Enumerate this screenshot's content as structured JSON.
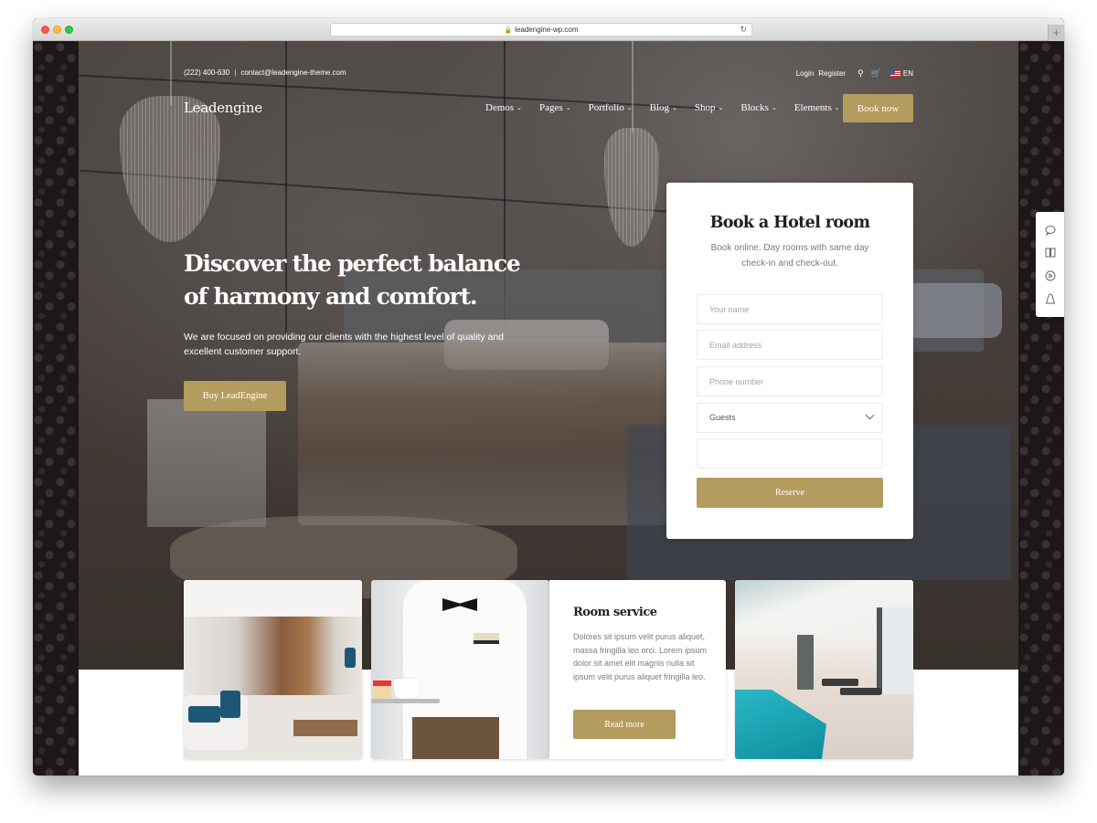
{
  "browser": {
    "url": "leadengine-wp.com",
    "lock_icon": "lock-icon",
    "reload_icon": "reload-icon",
    "new_tab_icon": "plus-icon"
  },
  "topbar": {
    "phone": "(222) 400-630",
    "separator": "|",
    "email": "contact@leadengine-theme.com",
    "login": "Login",
    "register": "Register",
    "language": "EN"
  },
  "header": {
    "logo": "Leadengine",
    "nav": [
      {
        "label": "Demos"
      },
      {
        "label": "Pages"
      },
      {
        "label": "Portfolio"
      },
      {
        "label": "Blog"
      },
      {
        "label": "Shop"
      },
      {
        "label": "Blocks"
      },
      {
        "label": "Elements"
      }
    ],
    "cta": "Book now"
  },
  "hero": {
    "title": "Discover the perfect balance of harmony and comfort.",
    "subtitle": "We are focused on providing our clients with the highest level of quality and excellent customer support.",
    "button": "Buy LeadEngine"
  },
  "booking": {
    "title": "Book a Hotel room",
    "subtitle": "Book online. Day rooms with same day check-in and check-out.",
    "fields": {
      "name_placeholder": "Your name",
      "email_placeholder": "Email address",
      "phone_placeholder": "Phone number",
      "guests_selected": "Guests",
      "extra_value": ""
    },
    "submit": "Reserve"
  },
  "side_tools": [
    "help-bubble-icon",
    "book-icon",
    "play-icon",
    "bag-icon"
  ],
  "features": {
    "card_title": "Room service",
    "card_body": "Dolores sit ipsum velit purus aliquet, massa fringilla leo orci. Lorem ipsum dolor sit amet elit magnis nulla sit ipsum velit purus aliquet fringilla leo.",
    "card_button": "Read more",
    "images": [
      "hotel-lobby-image",
      "waiter-image",
      "indoor-pool-image"
    ]
  },
  "colors": {
    "accent": "#b39c5e",
    "text_dark": "#1f1f1f",
    "text_muted": "#7a7a7a"
  }
}
